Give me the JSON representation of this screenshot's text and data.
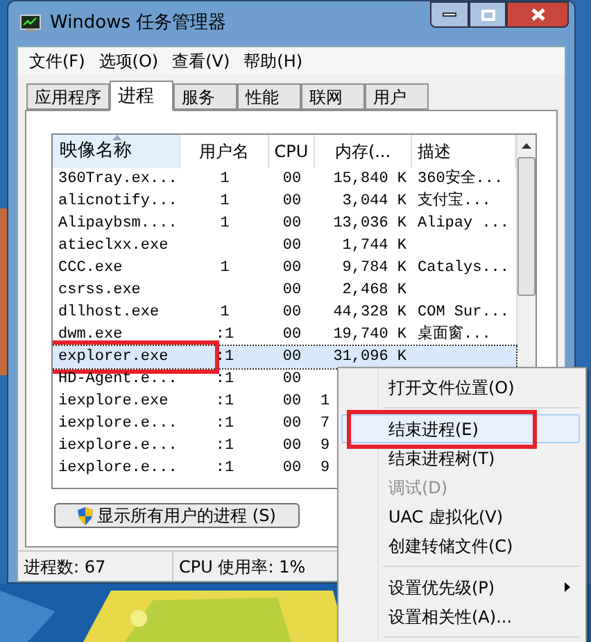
{
  "window": {
    "title": "Windows 任务管理器"
  },
  "menu_bar": [
    "文件(F)",
    "选项(O)",
    "查看(V)",
    "帮助(H)"
  ],
  "tabs": [
    {
      "label": "应用程序",
      "selected": false
    },
    {
      "label": "进程",
      "selected": true
    },
    {
      "label": "服务",
      "selected": false
    },
    {
      "label": "性能",
      "selected": false
    },
    {
      "label": "联网",
      "selected": false
    },
    {
      "label": "用户",
      "selected": false
    }
  ],
  "table": {
    "columns": [
      "映像名称",
      "用户名",
      "CPU",
      "内存(...",
      "描述"
    ],
    "rows": [
      {
        "cells": [
          "360Tray.ex...",
          "1",
          "00",
          "15,840 K",
          "360安全..."
        ],
        "selected": false,
        "covered": false
      },
      {
        "cells": [
          "alicnotify...",
          "1",
          "00",
          "3,044 K",
          "支付宝..."
        ],
        "selected": false,
        "covered": false
      },
      {
        "cells": [
          "Alipaybsm....",
          "1",
          "00",
          "13,036 K",
          "Alipay ..."
        ],
        "selected": false,
        "covered": false
      },
      {
        "cells": [
          "atieclxx.exe",
          "",
          "00",
          "1,744 K",
          ""
        ],
        "selected": false,
        "covered": false
      },
      {
        "cells": [
          "CCC.exe",
          "1",
          "00",
          "9,784 K",
          "Catalys..."
        ],
        "selected": false,
        "covered": false
      },
      {
        "cells": [
          "csrss.exe",
          "",
          "00",
          "2,468 K",
          ""
        ],
        "selected": false,
        "covered": false
      },
      {
        "cells": [
          "dllhost.exe",
          "1",
          "00",
          "44,328 K",
          "COM Sur..."
        ],
        "selected": false,
        "covered": false
      },
      {
        "cells": [
          "dwm.exe",
          ":1",
          "00",
          "19,740 K",
          "桌面窗..."
        ],
        "selected": false,
        "covered": false
      },
      {
        "cells": [
          "explorer.exe",
          ":1",
          "00",
          "31,096 K",
          ""
        ],
        "selected": true,
        "covered": false,
        "highlighted": true
      },
      {
        "cells": [
          "HD-Agent.e...",
          ":1",
          "00",
          "",
          ""
        ],
        "selected": false
      },
      {
        "cells": [
          "iexplore.exe",
          ":1",
          "00",
          "1",
          ""
        ],
        "selected": false,
        "covered": true
      },
      {
        "cells": [
          "iexplore.e...",
          ":1",
          "00",
          "7",
          ""
        ],
        "selected": false,
        "covered": true
      },
      {
        "cells": [
          "iexplore.e...",
          ":1",
          "00",
          "9",
          ""
        ],
        "selected": false,
        "covered": true
      },
      {
        "cells": [
          "iexplore.e...",
          ":1",
          "00",
          "9",
          ""
        ],
        "selected": false,
        "covered": true
      }
    ]
  },
  "show_all_button": {
    "label": "显示所有用户的进程 (S)"
  },
  "status_bar": [
    "进程数: 67",
    "CPU 使用率: 1%"
  ],
  "context_menu": [
    {
      "kind": "item",
      "label": "打开文件位置(O)",
      "disabled": false,
      "hovered": false,
      "highlighted": false,
      "submenu": false
    },
    {
      "kind": "separator"
    },
    {
      "kind": "item",
      "label": "结束进程(E)",
      "disabled": false,
      "hovered": true,
      "highlighted": true,
      "submenu": false
    },
    {
      "kind": "item",
      "label": "结束进程树(T)",
      "disabled": false,
      "hovered": false,
      "highlighted": false,
      "submenu": false
    },
    {
      "kind": "item",
      "label": "调试(D)",
      "disabled": true,
      "hovered": false,
      "highlighted": false,
      "submenu": false
    },
    {
      "kind": "item",
      "label": "UAC 虚拟化(V)",
      "disabled": false,
      "hovered": false,
      "highlighted": false,
      "submenu": false
    },
    {
      "kind": "item",
      "label": "创建转储文件(C)",
      "disabled": false,
      "hovered": false,
      "highlighted": false,
      "submenu": false
    },
    {
      "kind": "separator"
    },
    {
      "kind": "item",
      "label": "设置优先级(P)",
      "disabled": false,
      "hovered": false,
      "highlighted": false,
      "submenu": true
    },
    {
      "kind": "item",
      "label": "设置相关性(A)...",
      "disabled": false,
      "hovered": false,
      "highlighted": false,
      "submenu": false
    },
    {
      "kind": "separator"
    }
  ]
}
